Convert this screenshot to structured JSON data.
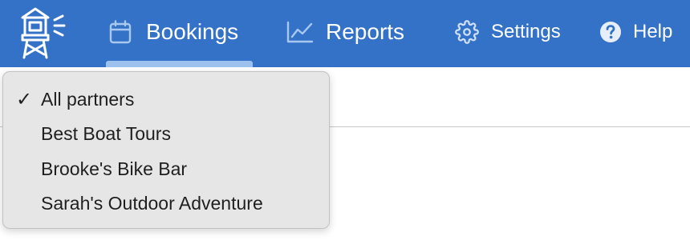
{
  "nav": {
    "logo_icon": "lighthouse-icon",
    "items": [
      {
        "label": "Bookings",
        "icon": "calendar-icon"
      },
      {
        "label": "Reports",
        "icon": "chart-line-icon"
      },
      {
        "label": "Settings",
        "icon": "gear-icon"
      },
      {
        "label": "Help",
        "icon": "question-circle-icon"
      }
    ],
    "active_item": "Bookings"
  },
  "partner_dropdown": {
    "selected": "All partners",
    "options": [
      {
        "label": "All partners",
        "checked": true
      },
      {
        "label": "Best Boat Tours",
        "checked": false
      },
      {
        "label": "Brooke's Bike Bar",
        "checked": false
      },
      {
        "label": "Sarah's Outdoor Adventure",
        "checked": false
      }
    ]
  },
  "colors": {
    "navbar_bg": "#3472c8",
    "active_underline": "#9cc1ee",
    "menu_bg": "#e6e6e6"
  }
}
